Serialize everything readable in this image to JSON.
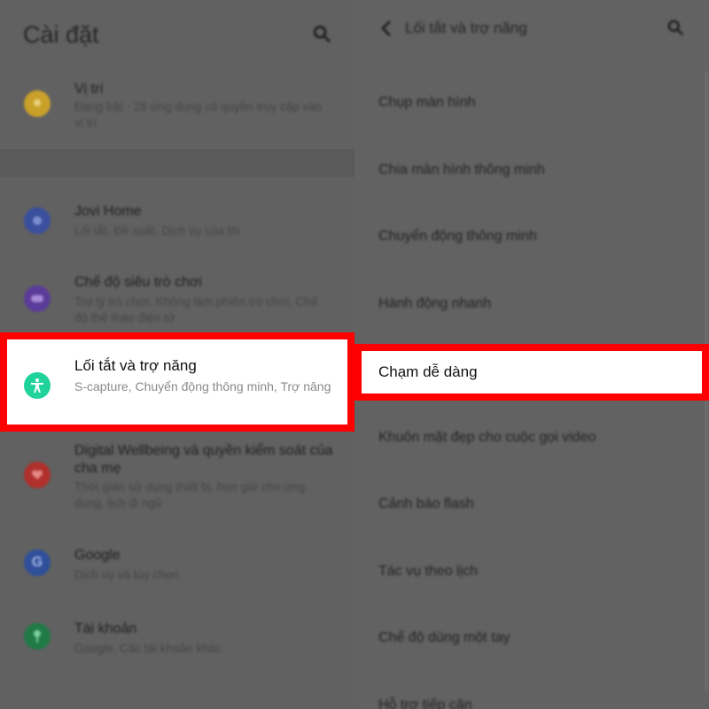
{
  "left_panel": {
    "title": "Cài đặt",
    "items": [
      {
        "title": "Vị trí",
        "subtitle": "Đang bật · 28 ứng dụng có quyền truy cập vào vị trí",
        "icon": "location-icon",
        "color": "#c9a12a"
      },
      {
        "title": "Jovi Home",
        "subtitle": "Lối tắt, Đề xuất, Dịch vụ của tôi",
        "icon": "jovi-icon",
        "color": "#3a4f9e"
      },
      {
        "title": "Chế độ siêu trò chơi",
        "subtitle": "Trợ lý trò chơi, Không làm phiền trò chơi, Chế độ thể thao điện tử",
        "icon": "gamepad-icon",
        "color": "#5b3c9a"
      },
      {
        "title": "Lối tắt và trợ năng",
        "subtitle": "S-capture, Chuyển động thông minh, Trợ năng",
        "icon": "accessibility-icon",
        "color": "#1fd39a"
      },
      {
        "title": "Digital Wellbeing và quyền kiểm soát của cha mẹ",
        "subtitle": "Thời gian sử dụng thiết bị, hẹn giờ cho ứng dụng, lịch đi ngủ",
        "icon": "heart-icon",
        "color": "#b0302c"
      },
      {
        "title": "Google",
        "subtitle": "Dịch vụ và tùy chọn",
        "icon": "google-icon",
        "color": "#2f4f9a"
      },
      {
        "title": "Tài khoản",
        "subtitle": "Google, Các tài khoản khác",
        "icon": "key-icon",
        "color": "#1f7a45"
      }
    ]
  },
  "right_panel": {
    "title": "Lối tắt và trợ năng",
    "items": [
      "Chụp màn hình",
      "Chia màn hình thông minh",
      "Chuyển động thông minh",
      "Hành động nhanh",
      "Chạm dễ dàng",
      "Khuôn mặt đẹp cho cuộc gọi video",
      "Cảnh báo flash",
      "Tác vụ theo lịch",
      "Chế độ dùng một tay",
      "Hỗ trợ tiếp cận"
    ]
  },
  "colors": {
    "highlight": "#ff0000",
    "accent": "#1fd39a"
  }
}
